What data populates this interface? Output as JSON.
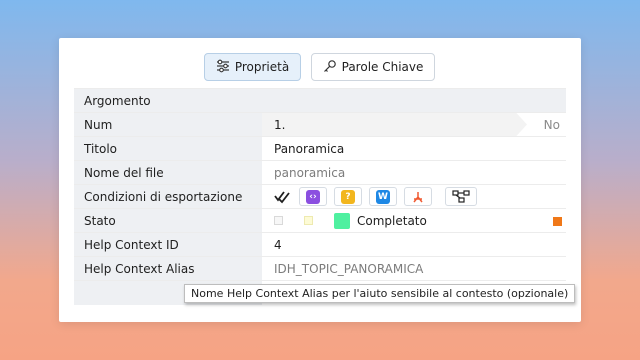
{
  "tabs": {
    "properties_label": "Proprietà",
    "keywords_label": "Parole Chiave"
  },
  "grid": {
    "header": "Argomento",
    "rows": {
      "num": {
        "label": "Num",
        "value": "1.",
        "suffix": "No"
      },
      "titolo": {
        "label": "Titolo",
        "value": "Panoramica"
      },
      "file": {
        "label": "Nome del file",
        "value": "panoramica"
      },
      "export": {
        "label": "Condizioni di esportazione",
        "icons": [
          "check-all-icon",
          "html-code-icon",
          "help-icon",
          "word-icon",
          "pdf-icon",
          "diagram-icon"
        ]
      },
      "stato": {
        "label": "Stato",
        "value": "Completato",
        "color": "#4ff0a0",
        "marker_color": "#f07818"
      },
      "context_id": {
        "label": "Help Context ID",
        "value": "4"
      },
      "context_alias": {
        "label": "Help Context Alias",
        "value": "IDH_TOPIC_PANORAMICA"
      }
    }
  },
  "tooltip": "Nome Help Context Alias per l'aiuto sensibile al contesto (opzionale)",
  "colors": {
    "accent_tab_bg": "#e6f0fa",
    "html_icon": "#8b4fe0",
    "help_icon": "#f2b61e",
    "word_icon": "#1e88e5",
    "pdf_icon": "#f05a32"
  }
}
